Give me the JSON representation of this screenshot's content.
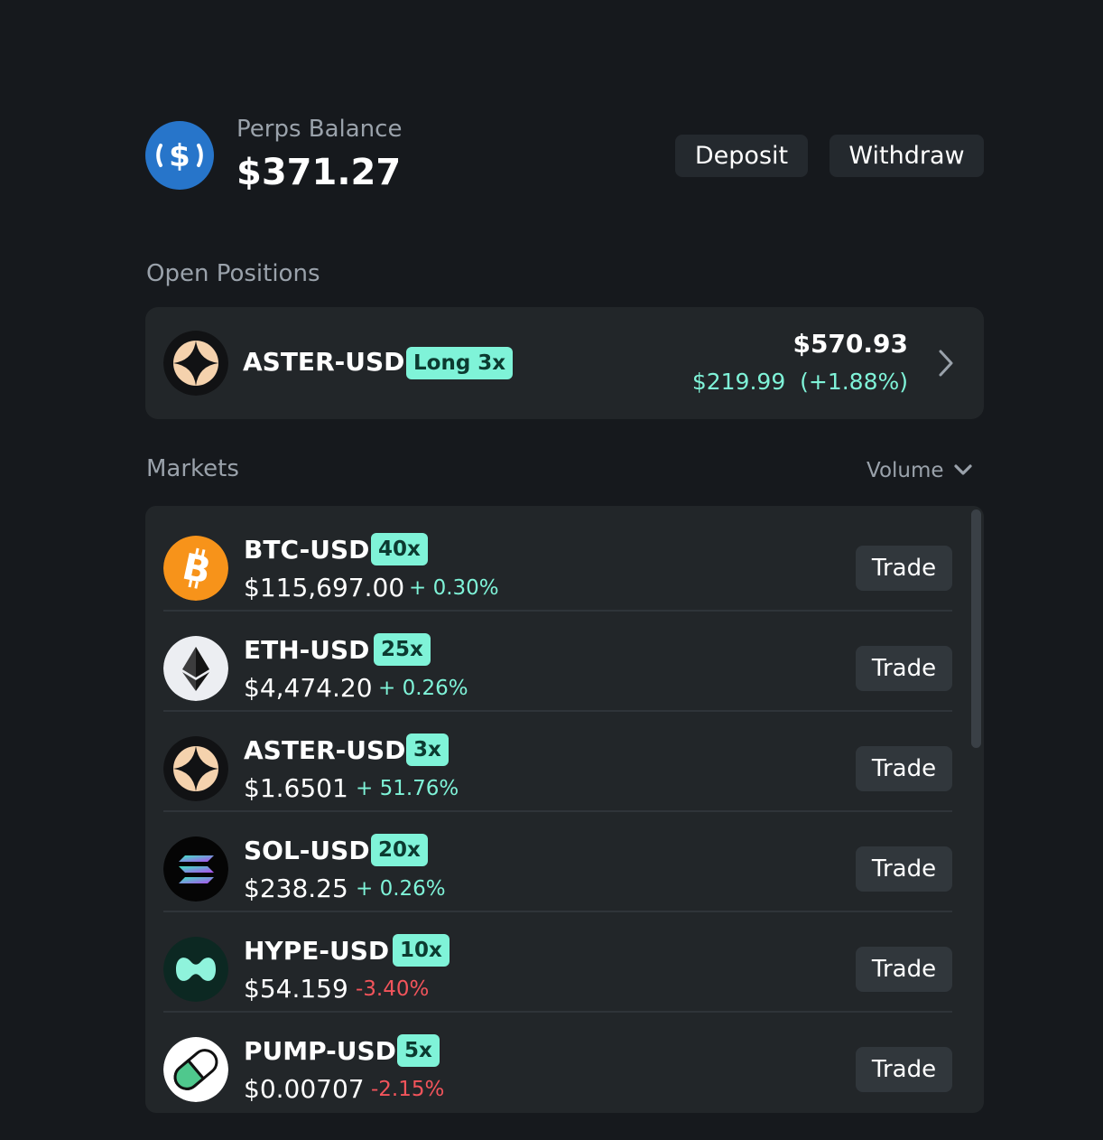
{
  "balance": {
    "label": "Perps Balance",
    "value": "$371.27",
    "icon": "usdc-icon"
  },
  "actions": {
    "deposit": "Deposit",
    "withdraw": "Withdraw"
  },
  "open_positions": {
    "label": "Open Positions",
    "items": [
      {
        "symbol": "ASTER-USD",
        "badge": "Long 3x",
        "value": "$570.93",
        "pnl": "$219.99  (+1.88%)",
        "icon": "aster-icon"
      }
    ]
  },
  "markets": {
    "label": "Markets",
    "sort_label": "Volume",
    "trade_label": "Trade",
    "items": [
      {
        "symbol": "BTC-USD",
        "leverage": "40x",
        "price": "$115,697.00",
        "change": "+ 0.30%",
        "direction": "up",
        "icon": "bitcoin-icon"
      },
      {
        "symbol": "ETH-USD",
        "leverage": "25x",
        "price": "$4,474.20",
        "change": "+ 0.26%",
        "direction": "up",
        "icon": "ethereum-icon"
      },
      {
        "symbol": "ASTER-USD",
        "leverage": "3x",
        "price": "$1.6501",
        "change": "+ 51.76%",
        "direction": "up",
        "icon": "aster-icon"
      },
      {
        "symbol": "SOL-USD",
        "leverage": "20x",
        "price": "$238.25",
        "change": "+ 0.26%",
        "direction": "up",
        "icon": "solana-icon"
      },
      {
        "symbol": "HYPE-USD",
        "leverage": "10x",
        "price": "$54.159",
        "change": "-3.40%",
        "direction": "down",
        "icon": "hyperliquid-icon"
      },
      {
        "symbol": "PUMP-USD",
        "leverage": "5x",
        "price": "$0.00707",
        "change": "-2.15%",
        "direction": "down",
        "icon": "pump-pill-icon"
      }
    ]
  },
  "colors": {
    "background": "#16191d",
    "card": "#222629",
    "accent": "#7ff3d8",
    "negative": "#f2545b",
    "muted": "#9aa2ab"
  }
}
